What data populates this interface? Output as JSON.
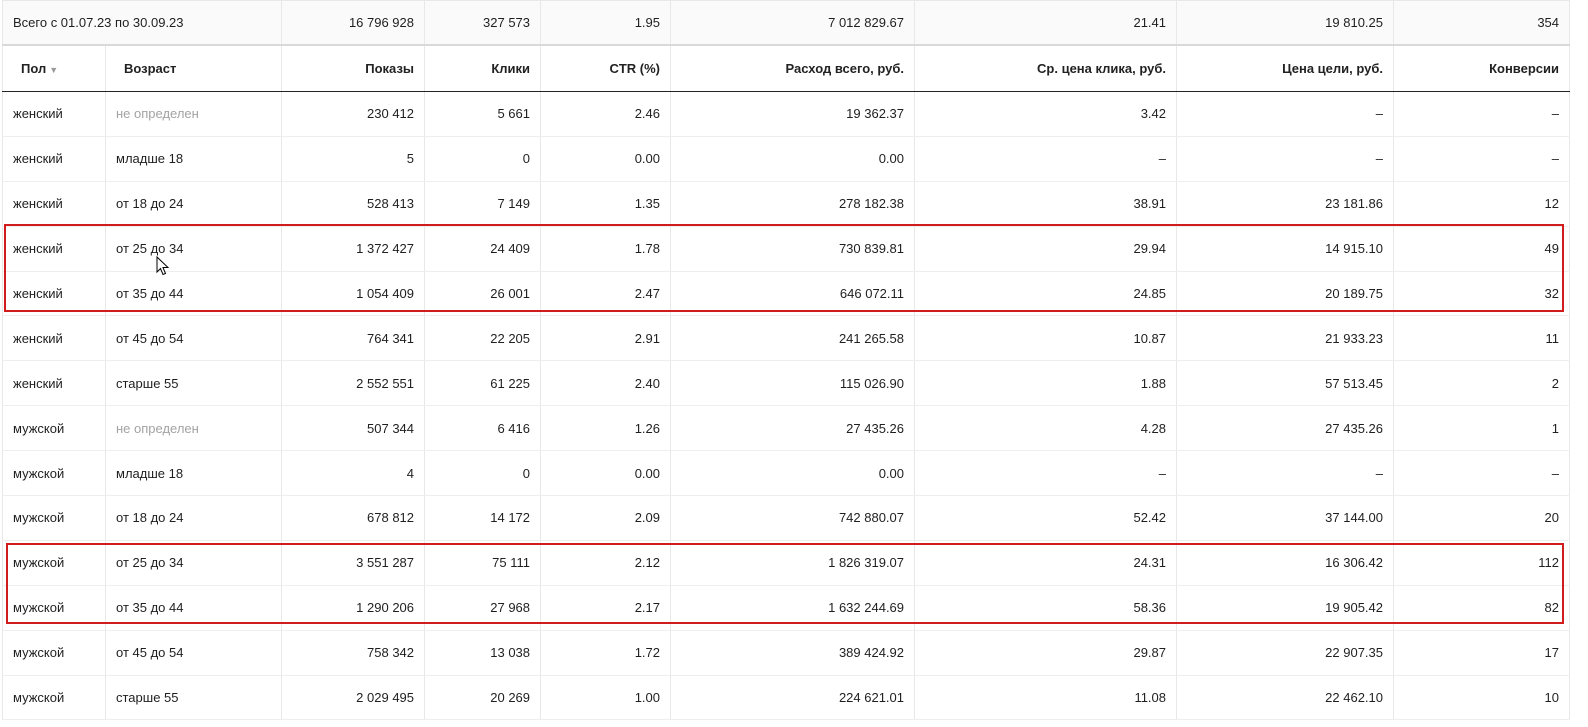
{
  "totals": {
    "label": "Всего с 01.07.23 по 30.09.23",
    "impressions": "16 796 928",
    "clicks": "327 573",
    "ctr": "1.95",
    "spend": "7 012 829.67",
    "avg_cpc": "21.41",
    "goal_cost": "19 810.25",
    "conversions": "354"
  },
  "columns": {
    "gender": "Пол",
    "age": "Возраст",
    "impressions": "Показы",
    "clicks": "Клики",
    "ctr": "CTR (%)",
    "spend": "Расход всего, руб.",
    "avg_cpc": "Ср. цена клика, руб.",
    "goal_cost": "Цена цели, руб.",
    "conversions": "Конверсии"
  },
  "sort_indicator": "▼",
  "rows": [
    {
      "gender": "женский",
      "age": "не определен",
      "impressions": "230 412",
      "clicks": "5 661",
      "ctr": "2.46",
      "spend": "19 362.37",
      "avg_cpc": "3.42",
      "goal_cost": "–",
      "conversions": "–"
    },
    {
      "gender": "женский",
      "age": "младше 18",
      "impressions": "5",
      "clicks": "0",
      "ctr": "0.00",
      "spend": "0.00",
      "avg_cpc": "–",
      "goal_cost": "–",
      "conversions": "–"
    },
    {
      "gender": "женский",
      "age": "от 18 до 24",
      "impressions": "528 413",
      "clicks": "7 149",
      "ctr": "1.35",
      "spend": "278 182.38",
      "avg_cpc": "38.91",
      "goal_cost": "23 181.86",
      "conversions": "12"
    },
    {
      "gender": "женский",
      "age": "от 25 до 34",
      "impressions": "1 372 427",
      "clicks": "24 409",
      "ctr": "1.78",
      "spend": "730 839.81",
      "avg_cpc": "29.94",
      "goal_cost": "14 915.10",
      "conversions": "49"
    },
    {
      "gender": "женский",
      "age": "от 35 до 44",
      "impressions": "1 054 409",
      "clicks": "26 001",
      "ctr": "2.47",
      "spend": "646 072.11",
      "avg_cpc": "24.85",
      "goal_cost": "20 189.75",
      "conversions": "32"
    },
    {
      "gender": "женский",
      "age": "от 45 до 54",
      "impressions": "764 341",
      "clicks": "22 205",
      "ctr": "2.91",
      "spend": "241 265.58",
      "avg_cpc": "10.87",
      "goal_cost": "21 933.23",
      "conversions": "11"
    },
    {
      "gender": "женский",
      "age": "старше 55",
      "impressions": "2 552 551",
      "clicks": "61 225",
      "ctr": "2.40",
      "spend": "115 026.90",
      "avg_cpc": "1.88",
      "goal_cost": "57 513.45",
      "conversions": "2"
    },
    {
      "gender": "мужской",
      "age": "не определен",
      "impressions": "507 344",
      "clicks": "6 416",
      "ctr": "1.26",
      "spend": "27 435.26",
      "avg_cpc": "4.28",
      "goal_cost": "27 435.26",
      "conversions": "1"
    },
    {
      "gender": "мужской",
      "age": "младше 18",
      "impressions": "4",
      "clicks": "0",
      "ctr": "0.00",
      "spend": "0.00",
      "avg_cpc": "–",
      "goal_cost": "–",
      "conversions": "–"
    },
    {
      "gender": "мужской",
      "age": "от 18 до 24",
      "impressions": "678 812",
      "clicks": "14 172",
      "ctr": "2.09",
      "spend": "742 880.07",
      "avg_cpc": "52.42",
      "goal_cost": "37 144.00",
      "conversions": "20"
    },
    {
      "gender": "мужской",
      "age": "от 25 до 34",
      "impressions": "3 551 287",
      "clicks": "75 111",
      "ctr": "2.12",
      "spend": "1 826 319.07",
      "avg_cpc": "24.31",
      "goal_cost": "16 306.42",
      "conversions": "112"
    },
    {
      "gender": "мужской",
      "age": "от 35 до 44",
      "impressions": "1 290 206",
      "clicks": "27 968",
      "ctr": "2.17",
      "spend": "1 632 244.69",
      "avg_cpc": "58.36",
      "goal_cost": "19 905.42",
      "conversions": "82"
    },
    {
      "gender": "мужской",
      "age": "от 45 до 54",
      "impressions": "758 342",
      "clicks": "13 038",
      "ctr": "1.72",
      "spend": "389 424.92",
      "avg_cpc": "29.87",
      "goal_cost": "22 907.35",
      "conversions": "17"
    },
    {
      "gender": "мужской",
      "age": "старше 55",
      "impressions": "2 029 495",
      "clicks": "20 269",
      "ctr": "1.00",
      "spend": "224 621.01",
      "avg_cpc": "11.08",
      "goal_cost": "22 462.10",
      "conversions": "10"
    }
  ],
  "muted_age_value": "не определен",
  "highlight_color": "#d01c1c"
}
